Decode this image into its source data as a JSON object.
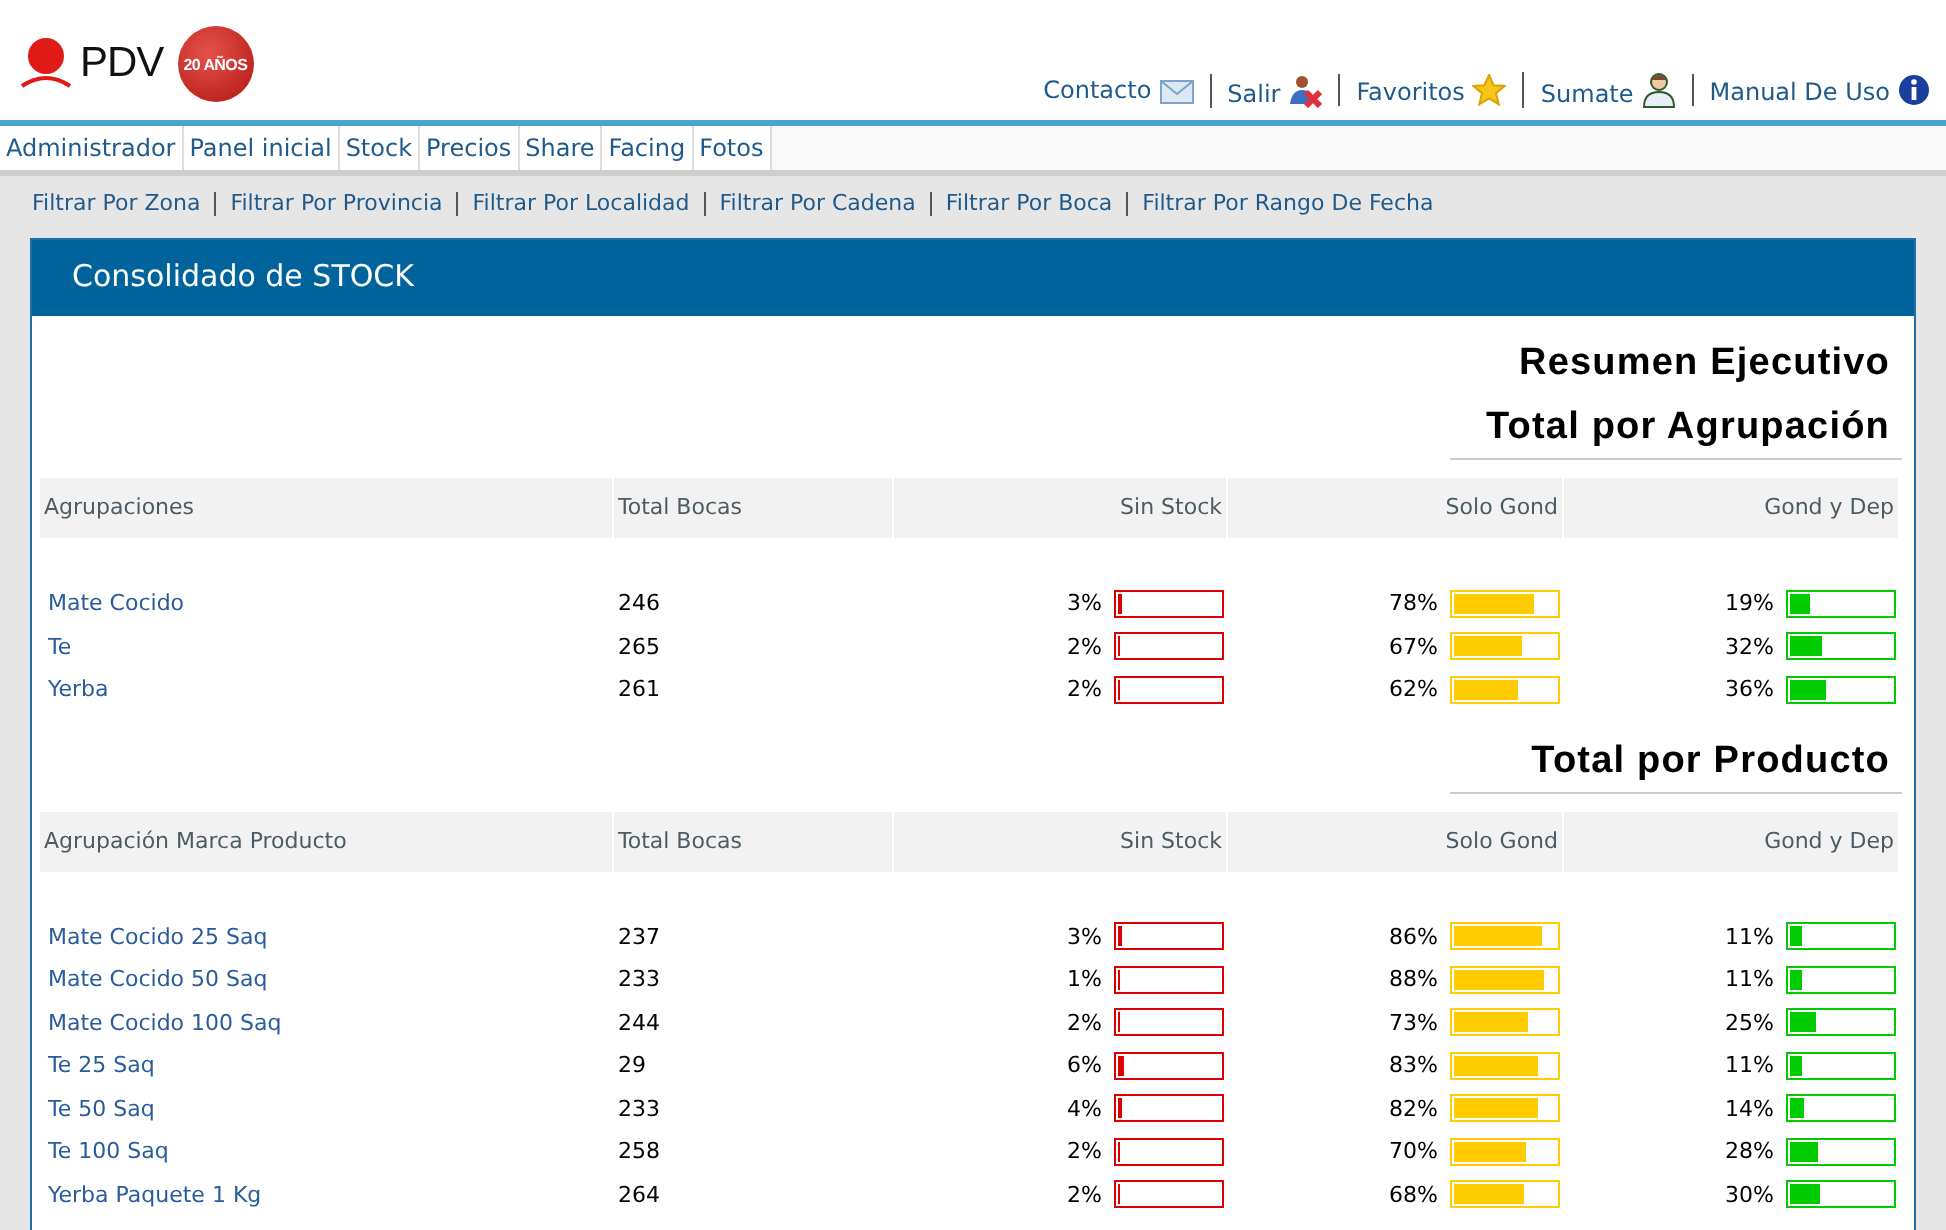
{
  "header": {
    "logo_text": "PDV",
    "badge_text": "20 AÑOS",
    "links": [
      {
        "label": "Contacto"
      },
      {
        "label": "Salir"
      },
      {
        "label": "Favoritos"
      },
      {
        "label": "Sumate"
      },
      {
        "label": "Manual De Uso"
      }
    ]
  },
  "menu": [
    {
      "label": "Administrador"
    },
    {
      "label": "Panel inicial"
    },
    {
      "label": "Stock"
    },
    {
      "label": "Precios"
    },
    {
      "label": "Share"
    },
    {
      "label": "Facing"
    },
    {
      "label": "Fotos"
    }
  ],
  "filters": [
    {
      "label": "Filtrar Por Zona"
    },
    {
      "label": "Filtrar Por Provincia"
    },
    {
      "label": "Filtrar Por Localidad"
    },
    {
      "label": "Filtrar Por Cadena"
    },
    {
      "label": "Filtrar Por Boca"
    },
    {
      "label": "Filtrar Por Rango De Fecha"
    }
  ],
  "panel": {
    "title": "Consolidado de STOCK",
    "summary_title": "Resumen Ejecutivo",
    "sections": [
      {
        "title": "Total por Agrupación",
        "columns": [
          {
            "label": "Agrupaciones"
          },
          {
            "label": "Total Bocas"
          },
          {
            "label": "Sin Stock"
          },
          {
            "label": "Solo Gond"
          },
          {
            "label": "Gond y Dep"
          }
        ],
        "rows": [
          {
            "name": "Mate Cocido",
            "total": "246",
            "metrics": [
              {
                "reading": "3%",
                "level": 0.03
              },
              {
                "reading": "78%",
                "level": 0.78
              },
              {
                "reading": "19%",
                "level": 0.19
              }
            ]
          },
          {
            "name": "Te",
            "total": "265",
            "metrics": [
              {
                "reading": "2%",
                "level": 0.02
              },
              {
                "reading": "67%",
                "level": 0.67
              },
              {
                "reading": "32%",
                "level": 0.32
              }
            ]
          },
          {
            "name": "Yerba",
            "total": "261",
            "metrics": [
              {
                "reading": "2%",
                "level": 0.02
              },
              {
                "reading": "62%",
                "level": 0.62
              },
              {
                "reading": "36%",
                "level": 0.36
              }
            ]
          }
        ]
      },
      {
        "title": "Total por Producto",
        "columns": [
          {
            "label": "Agrupación Marca Producto"
          },
          {
            "label": "Total Bocas"
          },
          {
            "label": "Sin Stock"
          },
          {
            "label": "Solo Gond"
          },
          {
            "label": "Gond y Dep"
          }
        ],
        "rows": [
          {
            "name": "Mate Cocido 25 Saq",
            "total": "237",
            "metrics": [
              {
                "reading": "3%",
                "level": 0.03
              },
              {
                "reading": "86%",
                "level": 0.86
              },
              {
                "reading": "11%",
                "level": 0.11
              }
            ]
          },
          {
            "name": "Mate Cocido 50 Saq",
            "total": "233",
            "metrics": [
              {
                "reading": "1%",
                "level": 0.01
              },
              {
                "reading": "88%",
                "level": 0.88
              },
              {
                "reading": "11%",
                "level": 0.11
              }
            ]
          },
          {
            "name": "Mate Cocido 100 Saq",
            "total": "244",
            "metrics": [
              {
                "reading": "2%",
                "level": 0.02
              },
              {
                "reading": "73%",
                "level": 0.73
              },
              {
                "reading": "25%",
                "level": 0.25
              }
            ]
          },
          {
            "name": "Te 25 Saq",
            "total": "29",
            "metrics": [
              {
                "reading": "6%",
                "level": 0.06
              },
              {
                "reading": "83%",
                "level": 0.83
              },
              {
                "reading": "11%",
                "level": 0.11
              }
            ]
          },
          {
            "name": "Te 50 Saq",
            "total": "233",
            "metrics": [
              {
                "reading": "4%",
                "level": 0.04
              },
              {
                "reading": "82%",
                "level": 0.82
              },
              {
                "reading": "14%",
                "level": 0.14
              }
            ]
          },
          {
            "name": "Te 100 Saq",
            "total": "258",
            "metrics": [
              {
                "reading": "2%",
                "level": 0.02
              },
              {
                "reading": "70%",
                "level": 0.7
              },
              {
                "reading": "28%",
                "level": 0.28
              }
            ]
          },
          {
            "name": "Yerba Paquete 1 Kg",
            "total": "264",
            "metrics": [
              {
                "reading": "2%",
                "level": 0.02
              },
              {
                "reading": "68%",
                "level": 0.68
              },
              {
                "reading": "30%",
                "level": 0.3
              }
            ]
          }
        ]
      }
    ]
  }
}
